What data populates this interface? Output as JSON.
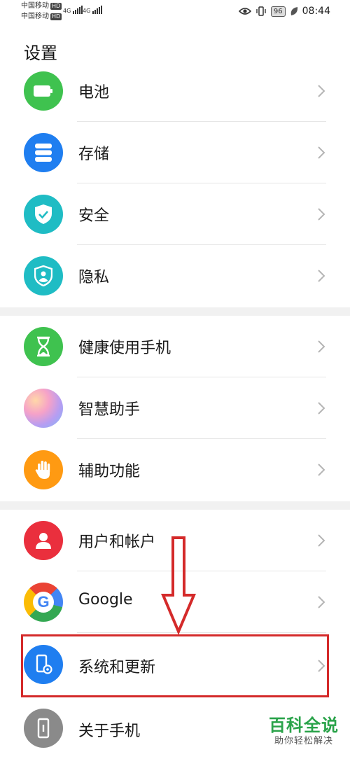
{
  "status_bar": {
    "carrier1": "中国移动",
    "carrier2": "中国移动",
    "hd": "HD",
    "net1": "4G",
    "net2": "4G",
    "battery": "96",
    "time": "08:44"
  },
  "page": {
    "title": "设置"
  },
  "settings": {
    "battery": "电池",
    "storage": "存储",
    "security": "安全",
    "privacy": "隐私",
    "digital_health": "健康使用手机",
    "assistant": "智慧助手",
    "accessibility": "辅助功能",
    "accounts": "用户和帐户",
    "google": "Google",
    "system": "系统和更新",
    "about": "关于手机"
  },
  "icons": {
    "battery": "battery-icon",
    "storage": "storage-icon",
    "security": "shield-check-icon",
    "privacy": "privacy-shield-user-icon",
    "digital_health": "hourglass-icon",
    "assistant": "ai-assistant-orb-icon",
    "accessibility": "hand-icon",
    "accounts": "user-icon",
    "google": "google-g-icon",
    "system": "phone-gear-icon",
    "about": "phone-icon"
  },
  "colors": {
    "green": "#3fc24f",
    "blue": "#1f7ef0",
    "teal": "#1fbcc4",
    "orange": "#ff9a12",
    "red": "#ea2f3d",
    "gray": "#8a8a8a",
    "annotation_red": "#d42a2a",
    "watermark_green": "#2aa34a"
  },
  "watermark": {
    "main": "百科全说",
    "sub": "助你轻松解决"
  }
}
